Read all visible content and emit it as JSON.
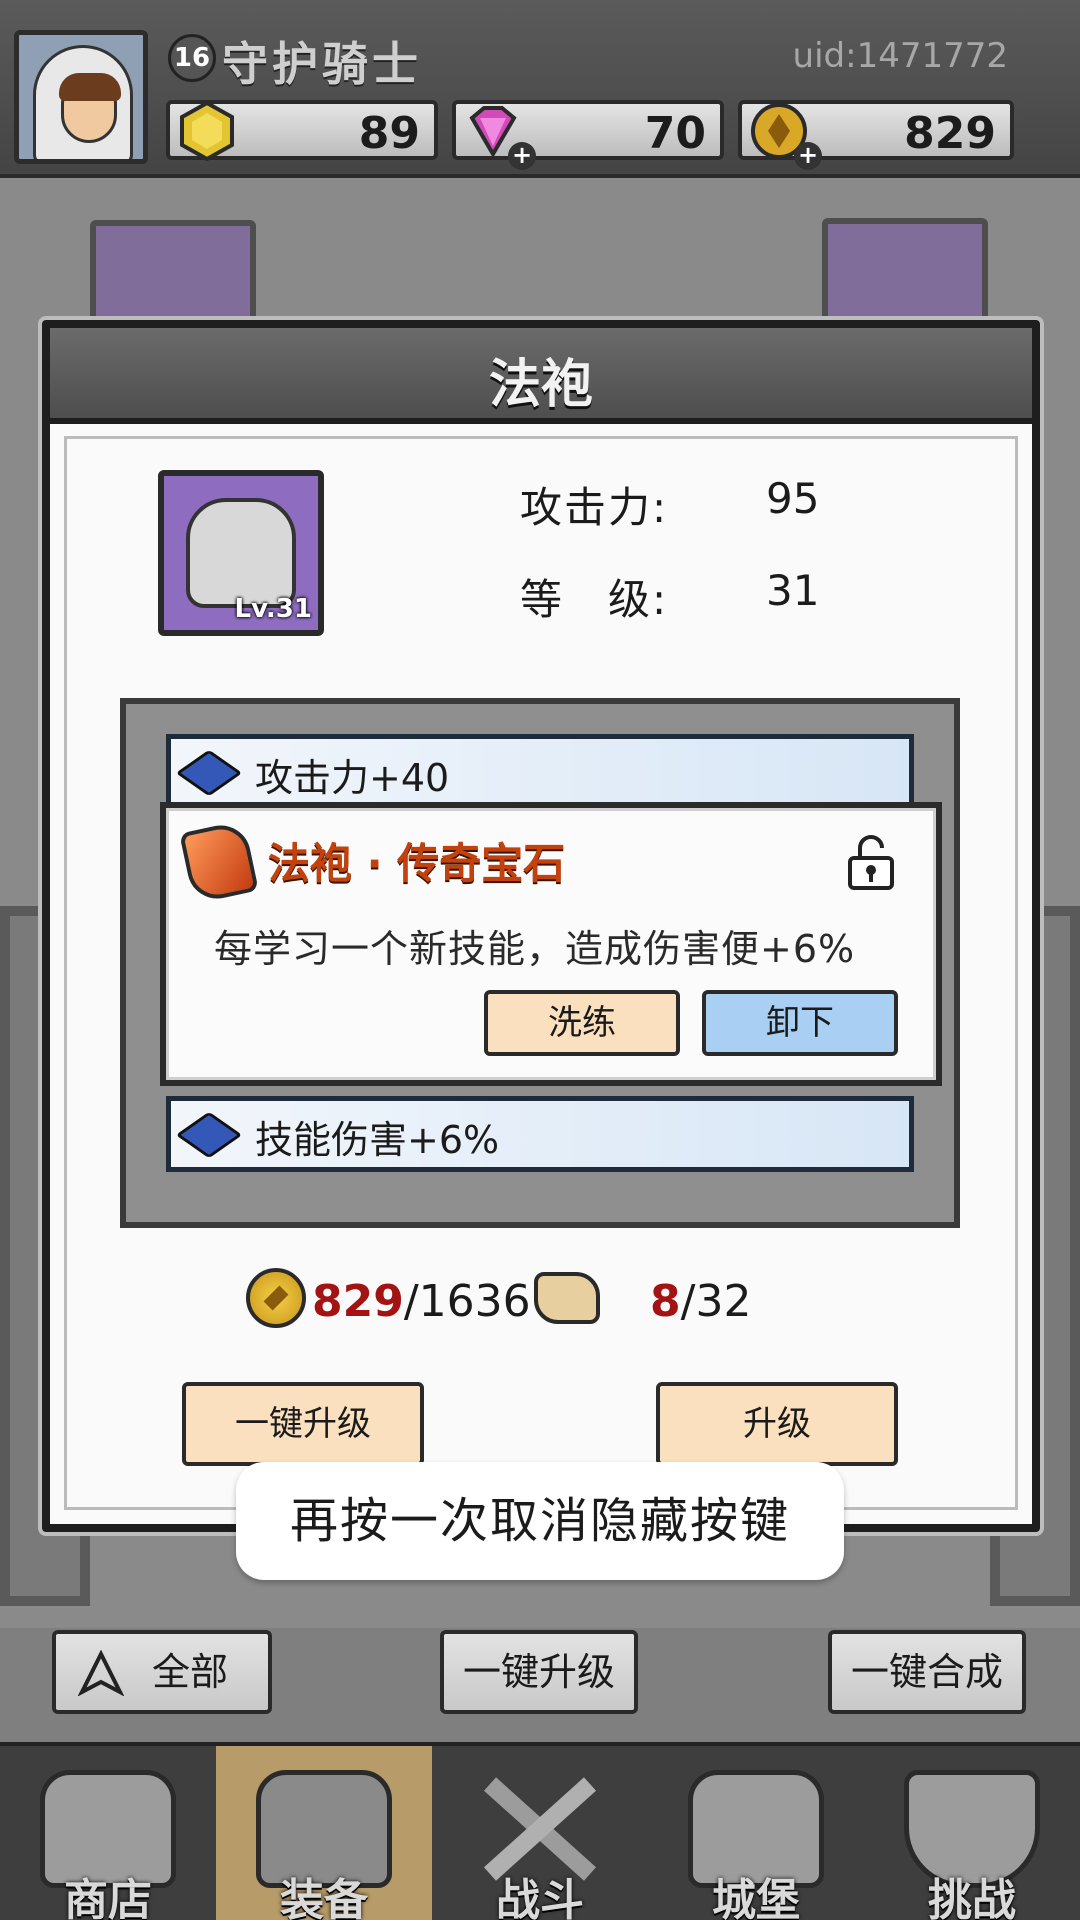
{
  "player": {
    "level": "16",
    "name": "守护骑士",
    "uid": "uid:1471772"
  },
  "resources": [
    {
      "name": "energy",
      "icon": "hexagon-gem-icon",
      "value": "89"
    },
    {
      "name": "diamond",
      "icon": "diamond-icon",
      "value": "70"
    },
    {
      "name": "coin",
      "icon": "gold-coin-icon",
      "value": "829"
    }
  ],
  "modal": {
    "title": "法袍",
    "item_level": "Lv.31",
    "stats": [
      {
        "label": "攻击力:",
        "value": "95"
      },
      {
        "label": "等　级:",
        "value": "31"
      }
    ],
    "gem_top": "攻击力+40",
    "gem_bottom": "技能伤害+6%",
    "legend": {
      "title": "法袍 · 传奇宝石",
      "desc": "每学习一个新技能，造成伤害便+6%",
      "btn_refine": "洗练",
      "btn_unequip": "卸下"
    },
    "cost": {
      "coin_have": "829",
      "coin_need": "/1636",
      "scroll_have": "8",
      "scroll_need": "/32"
    },
    "btn_one_key": "一键升级",
    "btn_upgrade": "升级"
  },
  "toast": "再按一次取消隐藏按键",
  "bottom_buttons": {
    "all": "全部",
    "one_key_upgrade": "一键升级",
    "one_key_merge": "一键合成"
  },
  "nav": [
    {
      "label": "商店",
      "active": false
    },
    {
      "label": "装备",
      "active": true
    },
    {
      "label": "战斗",
      "active": false
    },
    {
      "label": "城堡",
      "active": false
    },
    {
      "label": "挑战",
      "active": false
    }
  ],
  "colors": {
    "legend_title": "#c2410c",
    "peach_button": "#fbe0bf",
    "blue_button": "#a9d0f3",
    "item_slot": "#8e6cc0",
    "cost_highlight": "#a31313"
  }
}
